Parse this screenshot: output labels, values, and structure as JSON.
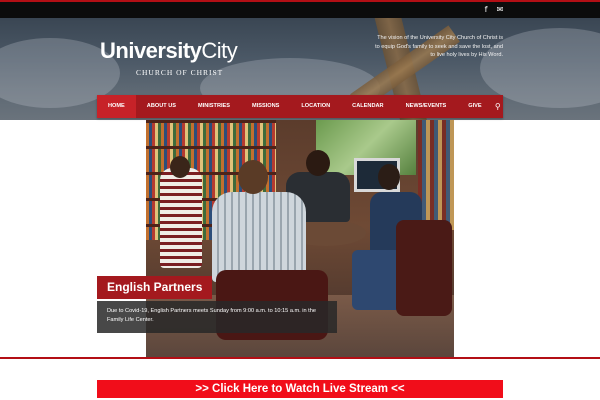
{
  "header": {
    "social": {
      "facebook_icon": "f",
      "email_icon": "✉"
    },
    "logo": {
      "bold": "University",
      "light": "City",
      "subtitle": "CHURCH OF CHRIST"
    },
    "vision": "The vision of the University City Church of Christ is to equip God's family to seek and save the lost, and to live holy lives by His Word."
  },
  "nav": {
    "items": [
      {
        "label": "HOME"
      },
      {
        "label": "ABOUT US"
      },
      {
        "label": "MINISTRIES"
      },
      {
        "label": "MISSIONS"
      },
      {
        "label": "LOCATION"
      },
      {
        "label": "CALENDAR"
      },
      {
        "label": "NEWS/EVENTS"
      },
      {
        "label": "GIVE"
      }
    ],
    "search_icon": "⚲",
    "active_color": "#c72228",
    "bar_color": "#a4191e"
  },
  "slider": {
    "title": "English Partners",
    "body": "Due to Covid-19, English Partners meets Sunday from 9:00 a.m. to 10:15 a.m. in the Family Life Center."
  },
  "livestream": {
    "label": ">> Click Here to Watch Live Stream <<",
    "color": "#f10d1a"
  }
}
